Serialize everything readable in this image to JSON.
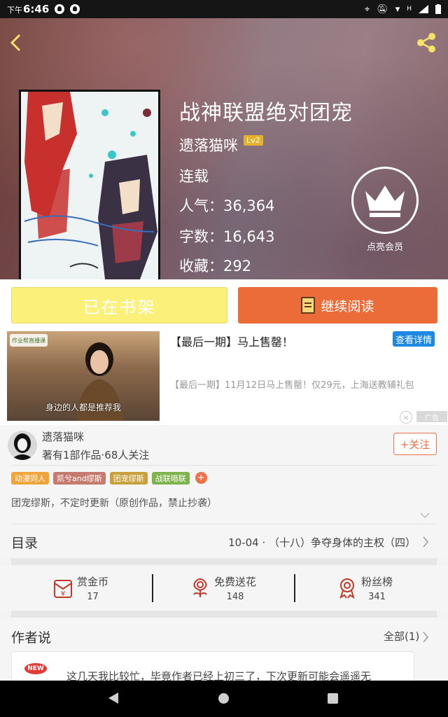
{
  "status_bar": {
    "ampm": "下午",
    "time": "6:46",
    "signal": "H"
  },
  "book": {
    "title": "战神联盟绝对团宠",
    "author": "遗落猫咪",
    "author_level": "Lv2",
    "status": "连载",
    "popularity": "人气：36,364",
    "words": "字数：16,643",
    "favorites": "收藏：292",
    "vip_label": "点亮会员"
  },
  "actions": {
    "shelf_label": "已在书架",
    "read_label": "继续阅读"
  },
  "ad": {
    "title": "【最后一期】马上售罄！",
    "detail_button": "查看详情",
    "description": "【最后一期】11月12日马上售罄！仅29元，上海送教辅礼包",
    "thumb_caption": "身边的人都是推荐我",
    "thumb_tag": "作业帮直播课",
    "ad_mark": "广告",
    "close": "×"
  },
  "author_info": {
    "name": "遗落猫咪",
    "meta": "著有1部作品·68人关注",
    "follow": "+关注",
    "tags": [
      {
        "label": "动漫同人",
        "color": "#f0a53a"
      },
      {
        "label": "凯兮and缪斯",
        "color": "#c57a6d"
      },
      {
        "label": "团宠缪斯",
        "color": "#c9a03c"
      },
      {
        "label": "战联暗联",
        "color": "#7fb34c"
      }
    ],
    "tag_plus": "+",
    "intro": "团宠缪斯，不定时更新（原创作品，禁止抄袭）"
  },
  "catalog": {
    "label": "目录",
    "latest": "10-04 · （十八）争夺身体的主权（四）"
  },
  "stats": {
    "coins": {
      "name": "赏金币",
      "value": "17"
    },
    "flowers": {
      "name": "免费送花",
      "value": "148"
    },
    "fans": {
      "name": "粉丝榜",
      "value": "341"
    }
  },
  "author_says": {
    "label": "作者说",
    "all": "全部(1)",
    "badge": "NEW",
    "text": "这几天我比较忙，毕竟作者已经上初三了，下次更新可能会遥遥无"
  },
  "colors": {
    "accent": "#ec6c39",
    "shelf": "#fbf17a",
    "follow": "#e8704b",
    "ad_button": "#1e88e5"
  }
}
